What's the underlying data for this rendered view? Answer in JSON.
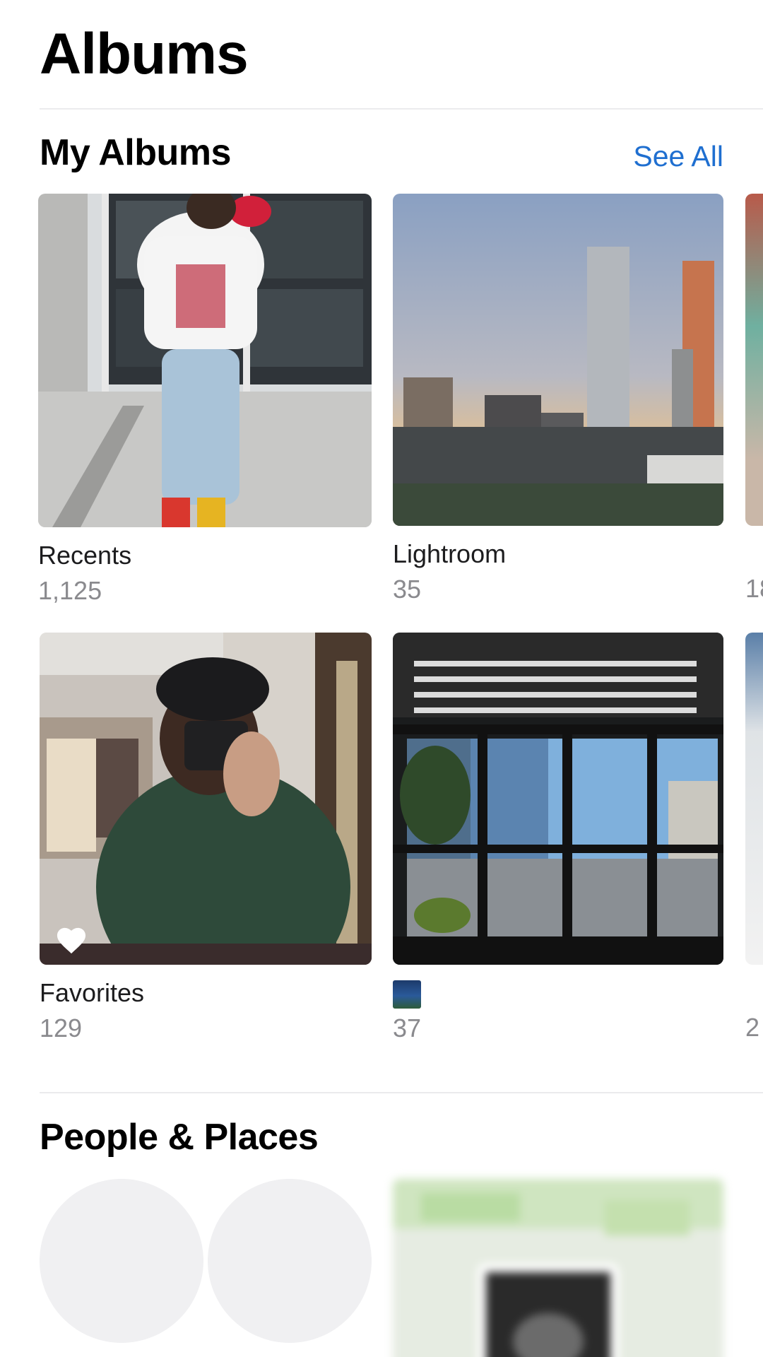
{
  "header": {
    "title": "Albums"
  },
  "my_albums": {
    "section_title": "My Albums",
    "see_all_label": "See All",
    "items": [
      {
        "name": "Recents",
        "count": "1,125"
      },
      {
        "name": "Lightroom",
        "count": "35"
      },
      {
        "name": "Favorites",
        "count": "129"
      },
      {
        "name": "",
        "count": "37"
      }
    ],
    "peek_counts": [
      "18",
      "2"
    ]
  },
  "people_places": {
    "section_title": "People & Places"
  },
  "colors": {
    "accent": "#1f6fd0",
    "secondary_text": "#8a8a8e",
    "divider": "#ebebed"
  }
}
